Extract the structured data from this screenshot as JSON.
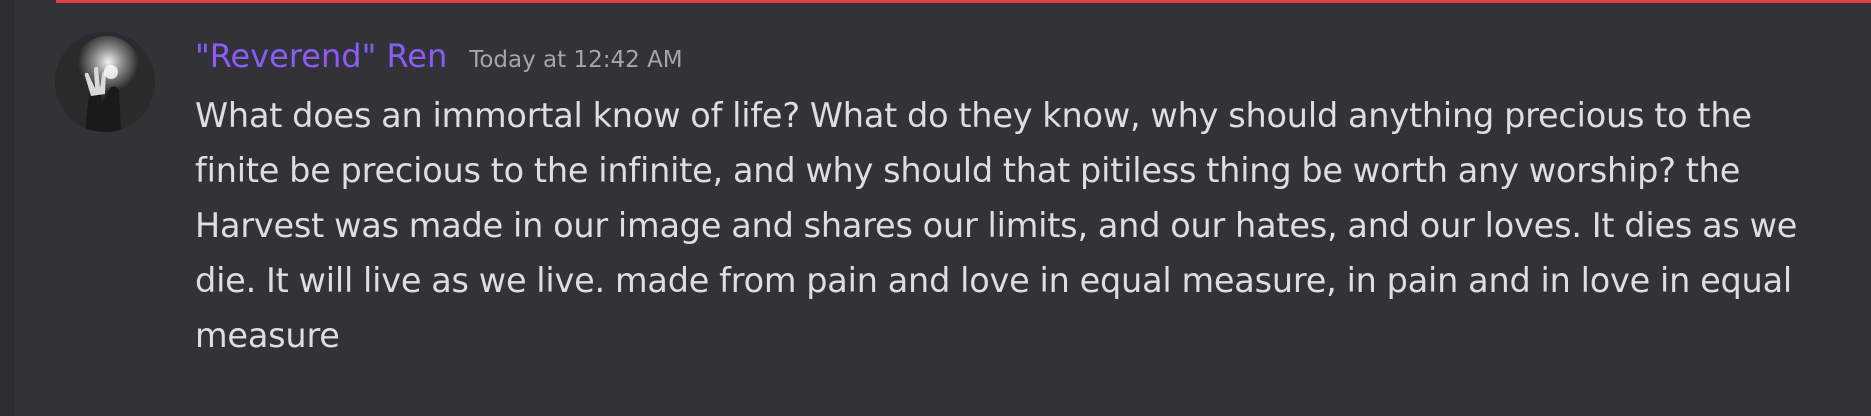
{
  "message": {
    "author": "\"Reverend\" Ren",
    "timestamp": "Today at 12:42 AM",
    "content": "What does an immortal know of life? What do they know, why should anything precious to the finite be precious to the infinite, and why should that pitiless thing be worth any worship? the Harvest was made in our image and shares our limits, and our hates, and our loves. It dies as we die. It will live as we live. made from pain and love in equal measure, in pain and in love in equal measure",
    "avatar_icon": "user-avatar-icon"
  },
  "colors": {
    "background": "#313338",
    "sidebar_strip": "#2b2d31",
    "new_messages_divider": "#e5404a",
    "username": "#8b5cf6",
    "timestamp": "#a3a6ad",
    "text": "#dcdee1"
  }
}
